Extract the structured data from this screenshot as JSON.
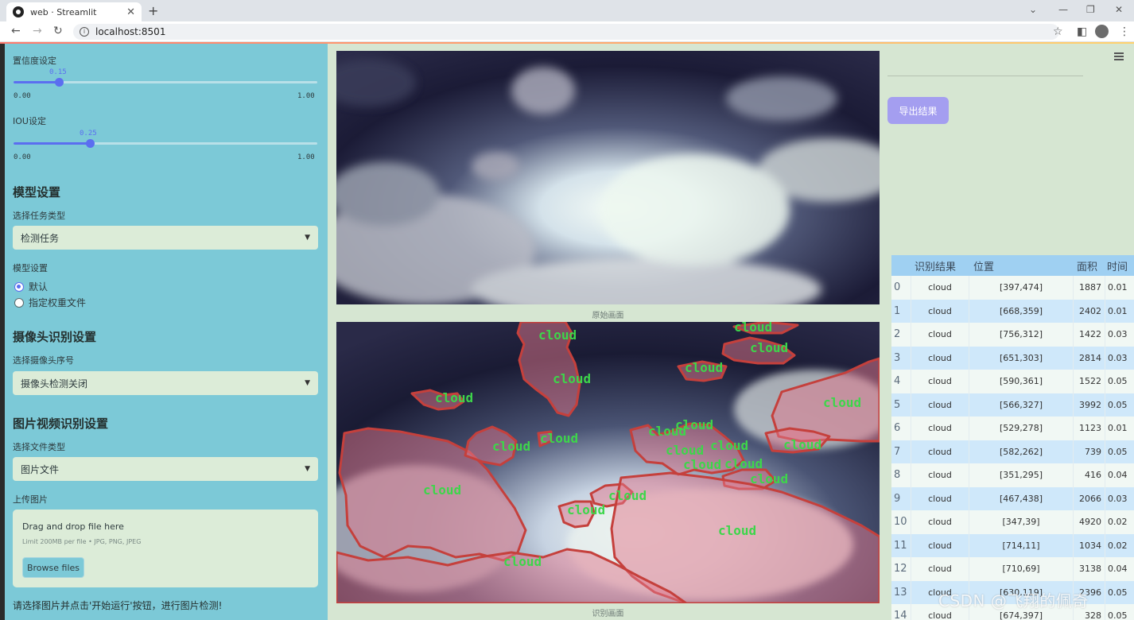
{
  "browser": {
    "tab_title": "web · Streamlit",
    "url": "localhost:8501"
  },
  "sidebar": {
    "confidence": {
      "label": "置信度设定",
      "value_text": "0.15",
      "value": 0.15,
      "min": "0.00",
      "max": "1.00"
    },
    "iou": {
      "label": "IOU设定",
      "value_text": "0.25",
      "value": 0.25,
      "min": "0.00",
      "max": "1.00"
    },
    "model_section": {
      "title": "模型设置",
      "task_label": "选择任务类型",
      "task_value": "检测任务",
      "weights_label": "模型设置",
      "options": [
        "默认",
        "指定权重文件"
      ],
      "selected_option": "默认"
    },
    "camera_section": {
      "title": "摄像头识别设置",
      "cam_label": "选择摄像头序号",
      "cam_value": "摄像头检测关闭"
    },
    "file_section": {
      "title": "图片视频识别设置",
      "type_label": "选择文件类型",
      "type_value": "图片文件",
      "upload_label": "上传图片",
      "drag_text": "Drag and drop file here",
      "limit_text": "Limit 200MB per file • JPG, PNG, JPEG",
      "browse_label": "Browse files"
    },
    "hint": "请选择图片并点击'开始运行'按钮，进行图片检测!"
  },
  "main": {
    "original_caption": "原始画面",
    "detected_caption": "识别画面",
    "detection_label": "cloud"
  },
  "right": {
    "export_label": "导出结果",
    "table": {
      "headers": [
        "识别结果",
        "位置",
        "面积",
        "时间"
      ],
      "rows": [
        {
          "idx": "0",
          "result": "cloud",
          "pos": "[397,474]",
          "area": "1887",
          "time": "0.01"
        },
        {
          "idx": "1",
          "result": "cloud",
          "pos": "[668,359]",
          "area": "2402",
          "time": "0.01"
        },
        {
          "idx": "2",
          "result": "cloud",
          "pos": "[756,312]",
          "area": "1422",
          "time": "0.03"
        },
        {
          "idx": "3",
          "result": "cloud",
          "pos": "[651,303]",
          "area": "2814",
          "time": "0.03"
        },
        {
          "idx": "4",
          "result": "cloud",
          "pos": "[590,361]",
          "area": "1522",
          "time": "0.05"
        },
        {
          "idx": "5",
          "result": "cloud",
          "pos": "[566,327]",
          "area": "3992",
          "time": "0.05"
        },
        {
          "idx": "6",
          "result": "cloud",
          "pos": "[529,278]",
          "area": "1123",
          "time": "0.01"
        },
        {
          "idx": "7",
          "result": "cloud",
          "pos": "[582,262]",
          "area": "739",
          "time": "0.05"
        },
        {
          "idx": "8",
          "result": "cloud",
          "pos": "[351,295]",
          "area": "416",
          "time": "0.04"
        },
        {
          "idx": "9",
          "result": "cloud",
          "pos": "[467,438]",
          "area": "2066",
          "time": "0.03"
        },
        {
          "idx": "10",
          "result": "cloud",
          "pos": "[347,39]",
          "area": "4920",
          "time": "0.02"
        },
        {
          "idx": "11",
          "result": "cloud",
          "pos": "[714,11]",
          "area": "1034",
          "time": "0.02"
        },
        {
          "idx": "12",
          "result": "cloud",
          "pos": "[710,69]",
          "area": "3138",
          "time": "0.04"
        },
        {
          "idx": "13",
          "result": "cloud",
          "pos": "[630,119]",
          "area": "2396",
          "time": "0.05"
        },
        {
          "idx": "14",
          "result": "cloud",
          "pos": "[674,397]",
          "area": "328",
          "time": "0.05"
        }
      ]
    }
  },
  "watermark": "CSDN @飞翔的佩奇"
}
